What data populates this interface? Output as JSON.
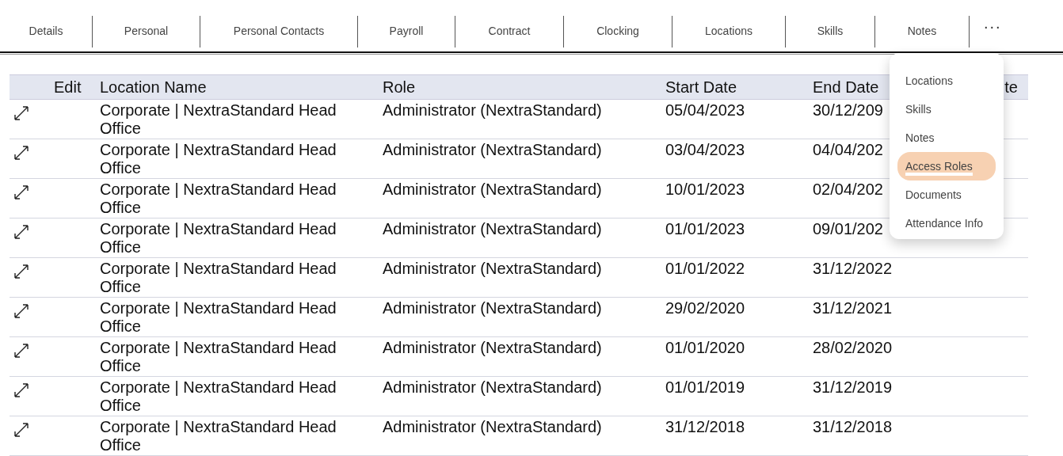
{
  "tabs": [
    {
      "label": "Details",
      "selected": false
    },
    {
      "label": "Personal",
      "selected": false
    },
    {
      "label": "Personal Contacts",
      "selected": false
    },
    {
      "label": "Payroll",
      "selected": false
    },
    {
      "label": "Contract",
      "selected": false
    },
    {
      "label": "Clocking",
      "selected": false
    },
    {
      "label": "Locations",
      "selected": false
    },
    {
      "label": "Skills",
      "selected": false
    },
    {
      "label": "Notes",
      "selected": false
    }
  ],
  "more_button": "...",
  "table": {
    "columns": [
      "Edit",
      "Location Name",
      "Role",
      "Start Date",
      "End Date",
      "te"
    ],
    "rows": [
      {
        "location": "Corporate | NextraStandard Head Office",
        "role": "Administrator (NextraStandard)",
        "start": "05/04/2023",
        "end": "30/12/209"
      },
      {
        "location": "Corporate | NextraStandard Head Office",
        "role": "Administrator (NextraStandard)",
        "start": "03/04/2023",
        "end": "04/04/202"
      },
      {
        "location": "Corporate | NextraStandard Head Office",
        "role": "Administrator (NextraStandard)",
        "start": "10/01/2023",
        "end": "02/04/202"
      },
      {
        "location": "Corporate | NextraStandard Head Office",
        "role": "Administrator (NextraStandard)",
        "start": "01/01/2023",
        "end": "09/01/202"
      },
      {
        "location": "Corporate | NextraStandard Head Office",
        "role": "Administrator (NextraStandard)",
        "start": "01/01/2022",
        "end": "31/12/2022"
      },
      {
        "location": "Corporate | NextraStandard Head Office",
        "role": "Administrator (NextraStandard)",
        "start": "29/02/2020",
        "end": "31/12/2021"
      },
      {
        "location": "Corporate | NextraStandard Head Office",
        "role": "Administrator (NextraStandard)",
        "start": "01/01/2020",
        "end": "28/02/2020"
      },
      {
        "location": "Corporate | NextraStandard Head Office",
        "role": "Administrator (NextraStandard)",
        "start": "01/01/2019",
        "end": "31/12/2019"
      },
      {
        "location": "Corporate | NextraStandard Head Office",
        "role": "Administrator (NextraStandard)",
        "start": "31/12/2018",
        "end": "31/12/2018"
      }
    ]
  },
  "dropdown": {
    "items": [
      {
        "label": "Locations",
        "selected": false
      },
      {
        "label": "Skills",
        "selected": false
      },
      {
        "label": "Notes",
        "selected": false
      },
      {
        "label": "Access Roles",
        "selected": true
      },
      {
        "label": "Documents",
        "selected": false
      },
      {
        "label": "Attendance Info",
        "selected": false
      }
    ]
  }
}
